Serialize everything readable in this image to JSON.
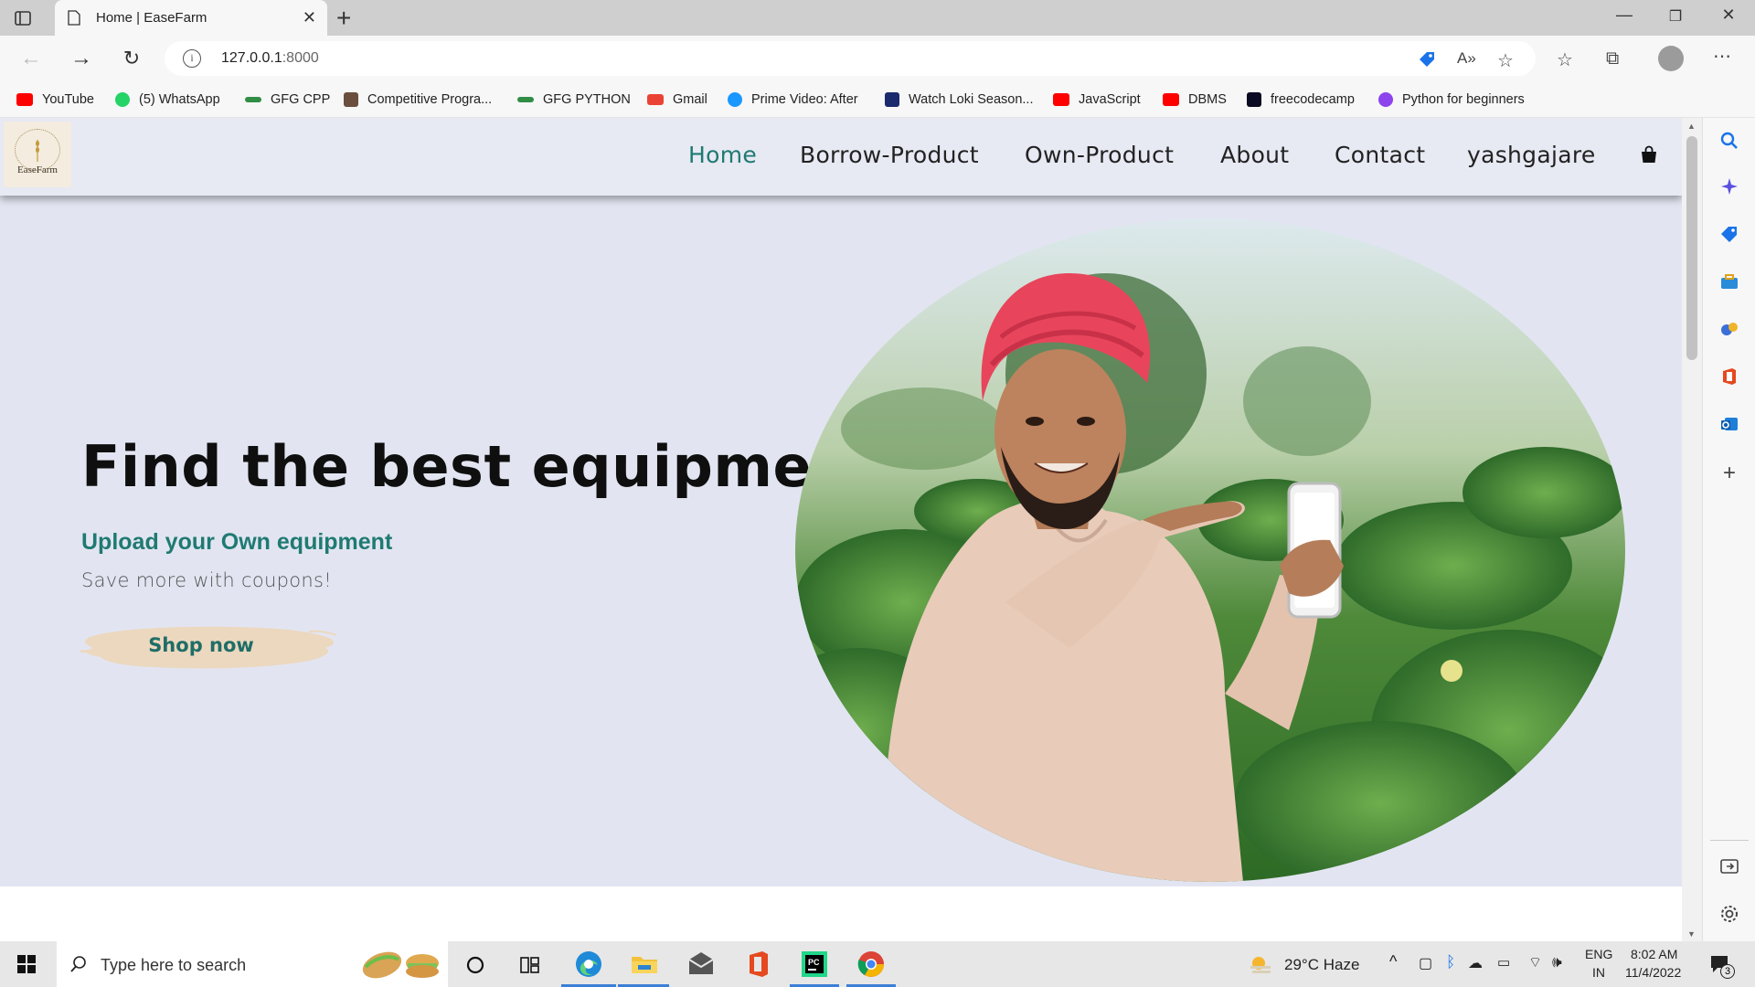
{
  "browser": {
    "tab_title": "Home | EaseFarm",
    "url_host": "127.0.0.1",
    "url_port": ":8000"
  },
  "bookmarks": [
    {
      "label": "YouTube",
      "color": "#ff0000"
    },
    {
      "label": "(5) WhatsApp",
      "color": "#25d366"
    },
    {
      "label": "GFG CPP",
      "color": "#2f8d46"
    },
    {
      "label": "Competitive Progra...",
      "color": "#6b4e3d"
    },
    {
      "label": "GFG PYTHON",
      "color": "#2f8d46"
    },
    {
      "label": "Gmail",
      "color": "#ea4335"
    },
    {
      "label": "Prime Video: After",
      "color": "#1a98ff"
    },
    {
      "label": "Watch Loki Season...",
      "color": "#1a2a6c"
    },
    {
      "label": "JavaScript",
      "color": "#ff0000"
    },
    {
      "label": "DBMS",
      "color": "#ff0000"
    },
    {
      "label": "freecodecamp",
      "color": "#0a0a23"
    },
    {
      "label": "Python for beginners",
      "color": "#8e44ec"
    }
  ],
  "site": {
    "logo_text": "EaseFarm",
    "nav": [
      {
        "label": "Home",
        "active": true
      },
      {
        "label": "Borrow-Product",
        "active": false
      },
      {
        "label": "Own-Product",
        "active": false
      },
      {
        "label": "About",
        "active": false
      },
      {
        "label": "Contact",
        "active": false
      },
      {
        "label": "yashgajare",
        "active": false
      }
    ],
    "accent_color": "#1f7a72",
    "hero": {
      "heading": "Find the best equipment",
      "subheading": "Upload your Own equipment",
      "tagline": "Save more with coupons!",
      "cta": "Shop now"
    }
  },
  "taskbar": {
    "search_placeholder": "Type here to search",
    "weather": "29°C  Haze",
    "lang_top": "ENG",
    "lang_bottom": "IN",
    "time": "8:02 AM",
    "date": "11/4/2022",
    "notifications": "3"
  }
}
